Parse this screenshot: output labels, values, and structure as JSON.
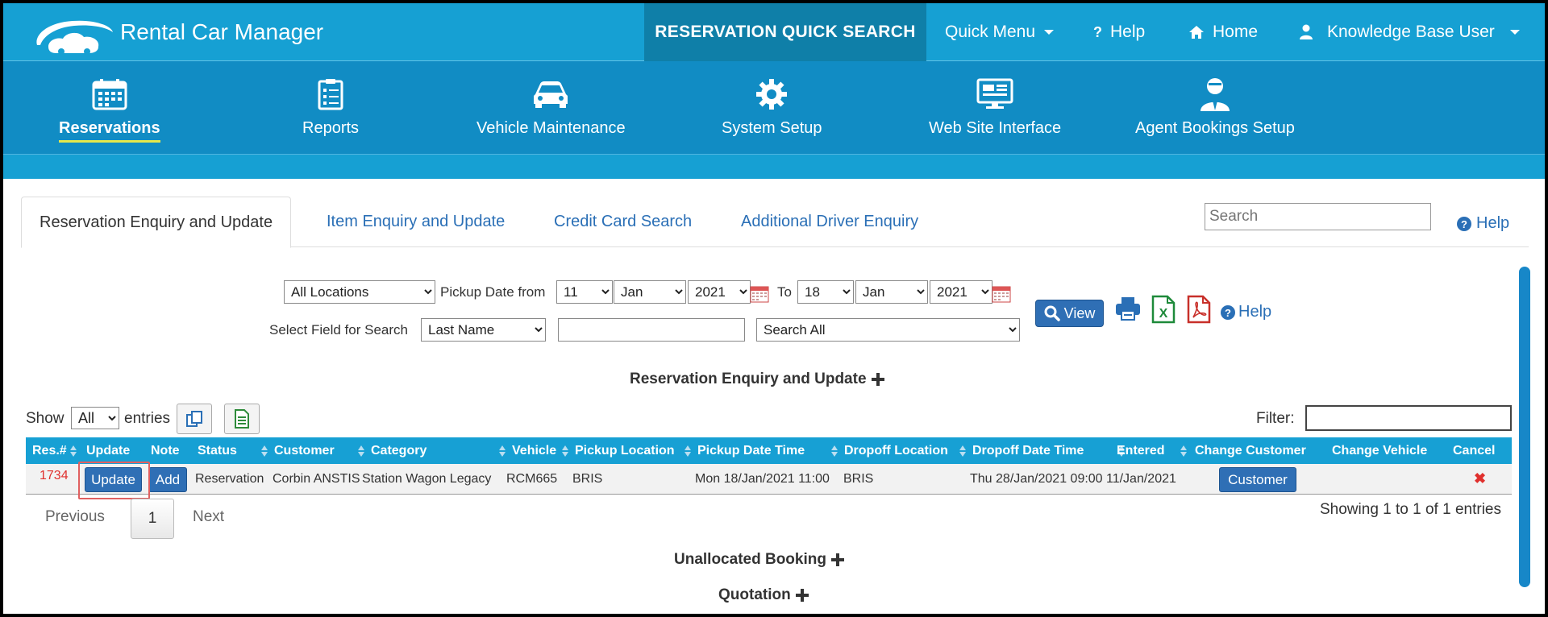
{
  "header": {
    "app_title": "Rental Car Manager",
    "quick_search": "RESERVATION QUICK SEARCH",
    "quick_menu": "Quick Menu",
    "help": "Help",
    "home": "Home",
    "user": "Knowledge Base User"
  },
  "modules": [
    {
      "label": "Reservations",
      "icon": "calendar-icon",
      "active": true
    },
    {
      "label": "Reports",
      "icon": "clipboard-icon"
    },
    {
      "label": "Vehicle Maintenance",
      "icon": "car-icon"
    },
    {
      "label": "System Setup",
      "icon": "gear-icon"
    },
    {
      "label": "Web Site Interface",
      "icon": "monitor-icon"
    },
    {
      "label": "Agent Bookings Setup",
      "icon": "agent-icon"
    }
  ],
  "tabs": [
    {
      "label": "Reservation Enquiry and Update",
      "active": true
    },
    {
      "label": "Item Enquiry and Update"
    },
    {
      "label": "Credit Card Search"
    },
    {
      "label": "Additional Driver Enquiry"
    }
  ],
  "search": {
    "placeholder": "Search"
  },
  "help_link": "Help",
  "filters": {
    "location": "All Locations",
    "pickup_from_label": "Pickup Date from",
    "from_day": "11",
    "from_month": "Jan",
    "from_year": "2021",
    "to_label": "To",
    "to_day": "18",
    "to_month": "Jan",
    "to_year": "2021",
    "field_label": "Select Field for Search",
    "field": "Last Name",
    "search_value": "",
    "scope": "Search All",
    "view_label": "View",
    "help_label": "Help"
  },
  "sections": {
    "enquiry": "Reservation Enquiry and Update",
    "unallocated": "Unallocated Booking",
    "quotation": "Quotation"
  },
  "table_controls": {
    "show_label": "Show",
    "show_value": "All",
    "entries_label": "entries",
    "filter_label": "Filter:"
  },
  "table": {
    "columns": [
      "Res.#",
      "Update",
      "Note",
      "Status",
      "Customer",
      "Category",
      "Vehicle",
      "Pickup Location",
      "Pickup Date Time",
      "Dropoff Location",
      "Dropoff Date Time",
      "Entered",
      "Change Customer",
      "Change Vehicle",
      "Cancel"
    ],
    "rows": [
      {
        "res_no": "1734",
        "update": "Update",
        "note": "Add",
        "status": "Reservation",
        "customer": "Corbin ANSTIS",
        "category": "Station Wagon Legacy",
        "vehicle": "RCM665",
        "pickup_location": "BRIS",
        "pickup_datetime": "Mon 18/Jan/2021 11:00",
        "dropoff_location": "BRIS",
        "dropoff_datetime": "Thu 28/Jan/2021 09:00",
        "entered": "11/Jan/2021",
        "change_customer": "Customer",
        "cancel": "✖"
      }
    ]
  },
  "pager": {
    "previous": "Previous",
    "page": "1",
    "next": "Next",
    "showing": "Showing 1 to 1 of 1 entries"
  },
  "colors": {
    "topbar": "#16a0d3",
    "modnav": "#118cc4",
    "button": "#2f6fb5",
    "res_no": "#e0302d"
  }
}
